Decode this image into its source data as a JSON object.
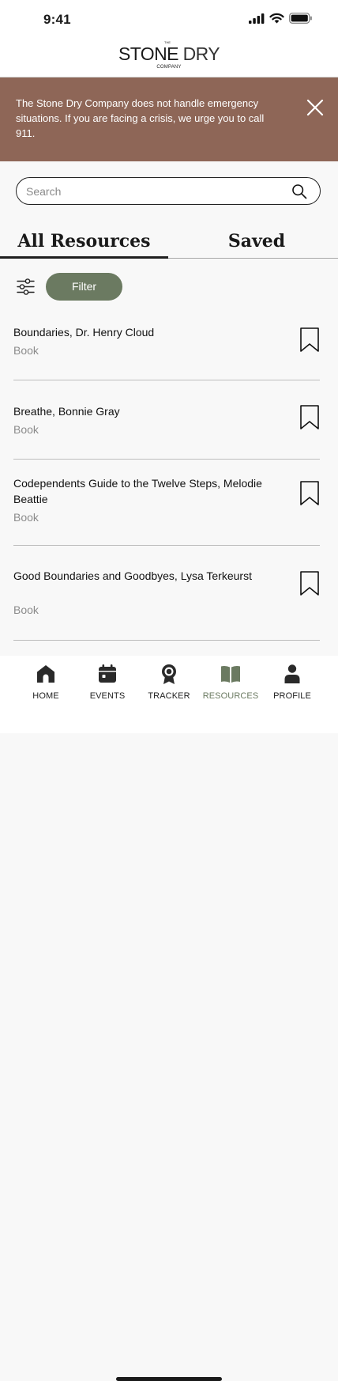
{
  "status_bar": {
    "time": "9:41"
  },
  "logo": {
    "the": "THE",
    "brand_bold": "STONE",
    "brand_light": "DRY",
    "company": "COMPANY"
  },
  "alert": {
    "text": "The Stone Dry Company does not handle emergency situations. If you are facing a crisis, we urge you to call  911.",
    "background": "#8e6657"
  },
  "search": {
    "placeholder": "Search",
    "value": "",
    "icon": "search-icon"
  },
  "tabs": [
    {
      "label": "All Resources",
      "active": true
    },
    {
      "label": "Saved",
      "active": false
    }
  ],
  "filter": {
    "label": "Filter",
    "icon": "sliders-icon",
    "color": "#6b7a61"
  },
  "resources": [
    {
      "title": "Boundaries, Dr. Henry Cloud",
      "type": "Book"
    },
    {
      "title": "Breathe, Bonnie Gray",
      "type": "Book"
    },
    {
      "title": "Codependents Guide to the Twelve Steps, Melodie Beattie",
      "type": "Book"
    },
    {
      "title": "Good Boundaries and Goodbyes, Lysa Terkeurst",
      "type": "Book"
    }
  ],
  "tabbar": [
    {
      "label": "HOME",
      "icon": "home-icon",
      "active": false
    },
    {
      "label": "EVENTS",
      "icon": "calendar-icon",
      "active": false
    },
    {
      "label": "TRACKER",
      "icon": "award-icon",
      "active": false
    },
    {
      "label": "RESOURCES",
      "icon": "book-icon",
      "active": true
    },
    {
      "label": "PROFILE",
      "icon": "person-icon",
      "active": false
    }
  ],
  "colors": {
    "accent": "#6b7a61",
    "alert": "#8e6657"
  }
}
